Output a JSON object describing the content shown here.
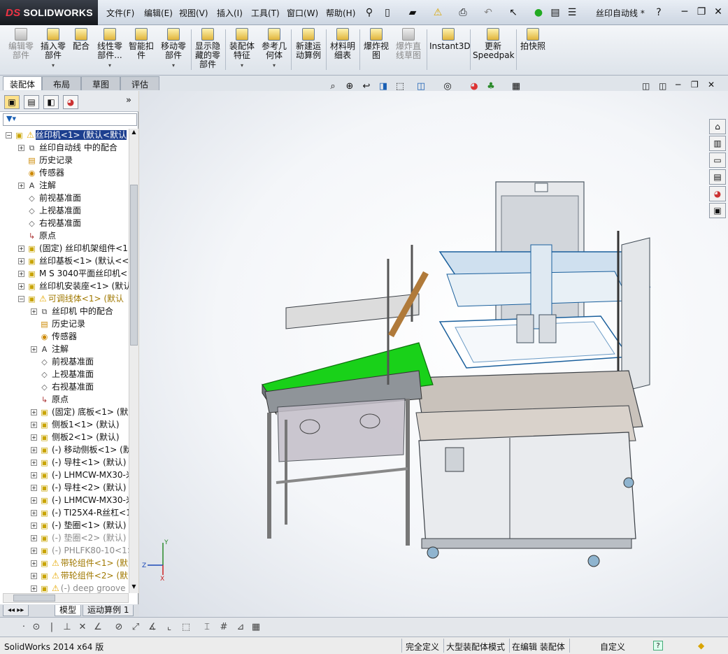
{
  "app": {
    "brand_ds": "DS",
    "brand_name": "SOLIDWORKS"
  },
  "menu": [
    "文件(F)",
    "编辑(E)",
    "视图(V)",
    "插入(I)",
    "工具(T)",
    "窗口(W)",
    "帮助(H)"
  ],
  "document_title": "丝印自动线 *",
  "command_manager": [
    {
      "label": "编辑零\n部件",
      "enabled": false
    },
    {
      "label": "插入零\n部件",
      "enabled": true
    },
    {
      "label": "配合",
      "enabled": true
    },
    {
      "label": "线性零\n部件...",
      "enabled": true
    },
    {
      "label": "智能扣\n件",
      "enabled": true
    },
    {
      "label": "移动零\n部件",
      "enabled": true
    },
    {
      "label": "显示隐\n藏的零\n部件",
      "enabled": true
    },
    {
      "label": "装配体\n特征",
      "enabled": true
    },
    {
      "label": "参考几\n何体",
      "enabled": true
    },
    {
      "label": "新建运\n动算例",
      "enabled": true
    },
    {
      "label": "材料明\n细表",
      "enabled": true
    },
    {
      "label": "爆炸视\n图",
      "enabled": true
    },
    {
      "label": "爆炸直\n线草图",
      "enabled": false
    },
    {
      "label": "Instant3D",
      "enabled": true
    },
    {
      "label": "更新\nSpeedpak",
      "enabled": true
    },
    {
      "label": "拍快照",
      "enabled": true
    }
  ],
  "tabs": [
    "装配体",
    "布局",
    "草图",
    "评估"
  ],
  "tree": [
    {
      "label": "丝印机<1> (默认<默认",
      "warn": true,
      "selected": true
    },
    {
      "label": "丝印自动线 中的配合"
    },
    {
      "label": "历史记录"
    },
    {
      "label": "传感器"
    },
    {
      "label": "注解"
    },
    {
      "label": "前视基准面"
    },
    {
      "label": "上视基准面"
    },
    {
      "label": "右视基准面"
    },
    {
      "label": "原点"
    },
    {
      "label": "(固定) 丝印机架组件<1"
    },
    {
      "label": "丝印基板<1> (默认<<默"
    },
    {
      "label": "M S 3040平面丝印机<"
    },
    {
      "label": "丝印机安装座<1> (默认"
    },
    {
      "label": "可调线体<1> (默认",
      "warn": true,
      "highlight": true
    },
    {
      "label": "丝印机 中的配合"
    },
    {
      "label": "历史记录"
    },
    {
      "label": "传感器"
    },
    {
      "label": "注解"
    },
    {
      "label": "前视基准面"
    },
    {
      "label": "上视基准面"
    },
    {
      "label": "右视基准面"
    },
    {
      "label": "原点"
    },
    {
      "label": "(固定) 底板<1> (默"
    },
    {
      "label": "侧板1<1> (默认)"
    },
    {
      "label": "侧板2<1> (默认)"
    },
    {
      "label": "(-) 移动侧板<1> (默"
    },
    {
      "label": "(-) 导柱<1> (默认)"
    },
    {
      "label": "(-) LHMCW-MX30-米"
    },
    {
      "label": "(-) 导柱<2> (默认)"
    },
    {
      "label": "(-) LHMCW-MX30-米"
    },
    {
      "label": "(-) TI25X4-R丝杠<1"
    },
    {
      "label": "(-) 垫圈<1> (默认)"
    },
    {
      "label": "(-) 垫圈<2> (默认)",
      "dim": true
    },
    {
      "label": "(-) PHLFK80-10<1>",
      "dim": true
    },
    {
      "label": "带轮组件<1> (默",
      "warn": true,
      "highlight": true
    },
    {
      "label": "带轮组件<2> (默",
      "warn": true,
      "highlight": true
    },
    {
      "label": "(-) deep groove b",
      "warn": true,
      "dim": true
    }
  ],
  "bottom_tabs": [
    "模型",
    "运动算例 1"
  ],
  "status": {
    "version": "SolidWorks 2014 x64 版",
    "definition": "完全定义",
    "mode": "大型装配体模式",
    "editing": "在编辑 装配体",
    "units": "自定义"
  },
  "triad": {
    "x": "X",
    "y": "Y",
    "z": "Z"
  }
}
